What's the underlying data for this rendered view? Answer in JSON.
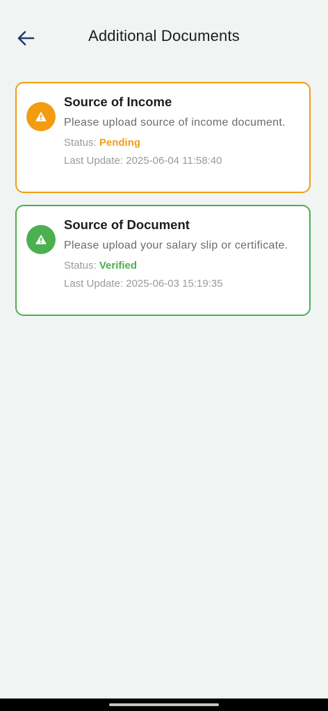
{
  "header": {
    "title": "Additional Documents",
    "back_icon": "arrow-left-icon"
  },
  "colors": {
    "background": "#f0f4f3",
    "pending": "#f39c12",
    "verified": "#4caf50",
    "back_arrow": "#1f3a6e"
  },
  "documents": [
    {
      "title": "Source of Income",
      "description": "Please upload source of income document.",
      "status_label": "Status: ",
      "status": "Pending",
      "last_update_label": "Last Update: ",
      "last_update": "2025-06-04 11:58:40",
      "icon": "warning-icon"
    },
    {
      "title": "Source of Document",
      "description": "Please upload your salary slip or certificate.",
      "status_label": "Status: ",
      "status": "Verified",
      "last_update_label": "Last Update: ",
      "last_update": "2025-06-03 15:19:35",
      "icon": "warning-icon"
    }
  ]
}
